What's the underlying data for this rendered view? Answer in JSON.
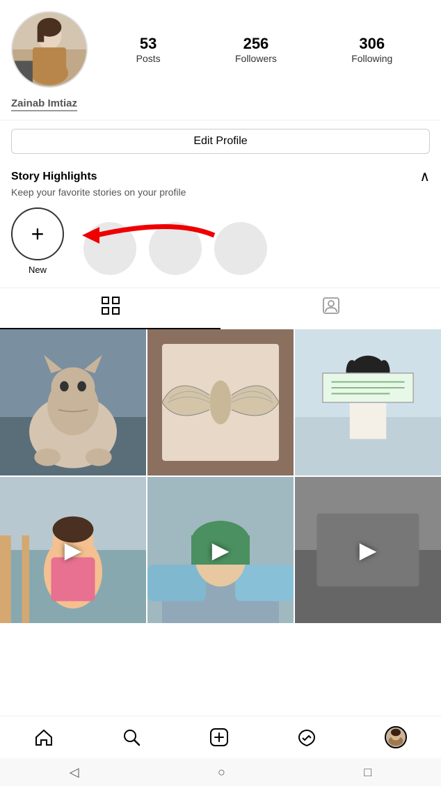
{
  "profile": {
    "username": "Zainab Imtiaz",
    "stats": {
      "posts_count": "53",
      "posts_label": "Posts",
      "followers_count": "256",
      "followers_label": "Followers",
      "following_count": "306",
      "following_label": "Following"
    }
  },
  "buttons": {
    "edit_profile": "Edit Profile"
  },
  "story_highlights": {
    "title": "Story Highlights",
    "subtitle": "Keep your favorite stories on your profile",
    "new_label": "New",
    "chevron": "^"
  },
  "tabs": {
    "grid_label": "Grid",
    "tagged_label": "Tagged"
  },
  "nav": {
    "home": "Home",
    "search": "Search",
    "create": "Create",
    "activity": "Activity",
    "profile": "Profile"
  },
  "android": {
    "back": "◁",
    "home": "○",
    "recents": "□"
  }
}
